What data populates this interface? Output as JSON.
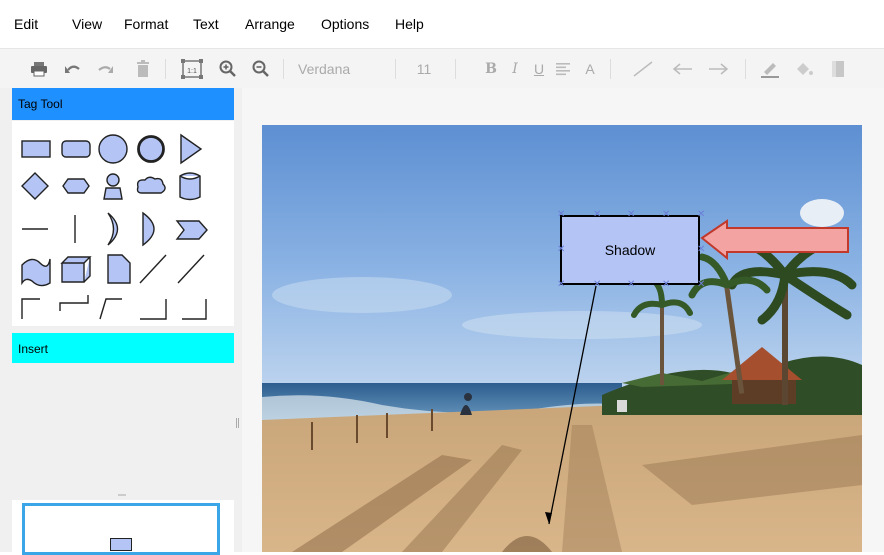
{
  "menu": {
    "items": [
      "Edit",
      "View",
      "Format",
      "Text",
      "Arrange",
      "Options",
      "Help"
    ]
  },
  "toolbar": {
    "font_name": "Verdana",
    "font_size": "11",
    "bold": "B",
    "italic": "I",
    "underline": "U",
    "font_color": "A"
  },
  "sidebar": {
    "tag_tool_title": "Tag Tool",
    "insert_title": "Insert",
    "tag_tool_color": "#1e90ff",
    "insert_color": "#00ffff"
  },
  "canvas": {
    "shape_label": "Shadow",
    "shape_fill": "#b3c4f5",
    "arrow_fill": "#f4a3a3",
    "arrow_stroke": "#c0392b"
  }
}
